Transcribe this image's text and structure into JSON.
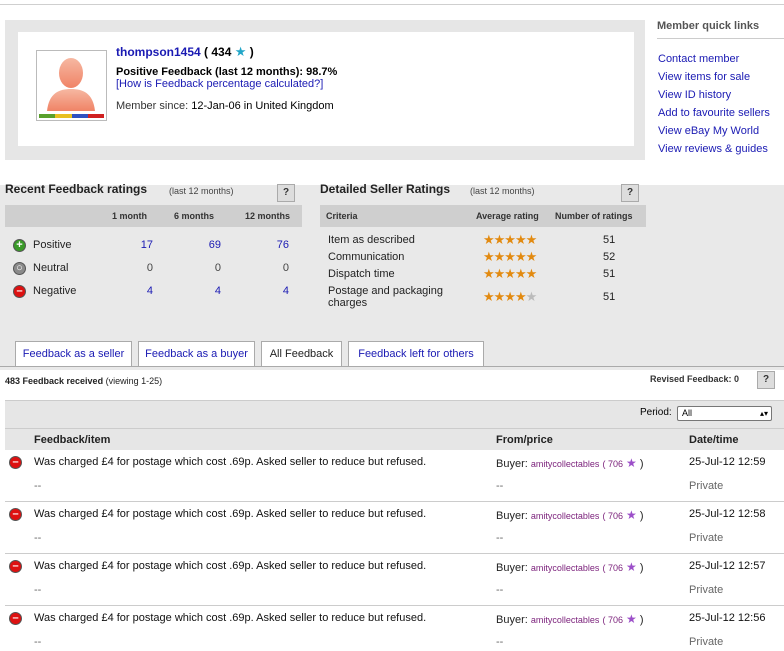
{
  "profile": {
    "username": "thompson1454",
    "score": "434",
    "positive_feedback": "Positive Feedback (last 12 months): 98.7%",
    "how_calc": "[How is Feedback percentage calculated?]",
    "member_since_label": "Member since:",
    "member_since_value": "12-Jan-06 in United Kingdom"
  },
  "quick_links": {
    "title": "Member quick links",
    "items": [
      "Contact member",
      "View items for sale",
      "View ID history",
      "Add to favourite sellers",
      "View eBay My World",
      "View reviews & guides"
    ]
  },
  "recent": {
    "title": "Recent Feedback ratings",
    "sub": "(last 12 months)",
    "help": "?",
    "cols": [
      "1 month",
      "6 months",
      "12 months"
    ],
    "rows": [
      {
        "label": "Positive",
        "v1": "17",
        "v6": "69",
        "v12": "76"
      },
      {
        "label": "Neutral",
        "v1": "0",
        "v6": "0",
        "v12": "0"
      },
      {
        "label": "Negative",
        "v1": "4",
        "v6": "4",
        "v12": "4"
      }
    ]
  },
  "dsr": {
    "title": "Detailed Seller Ratings",
    "sub": "(last 12 months)",
    "help": "?",
    "cols": [
      "Criteria",
      "Average rating",
      "Number of ratings"
    ],
    "rows": [
      {
        "label": "Item as described",
        "rating": 5,
        "count": "51"
      },
      {
        "label": "Communication",
        "rating": 5,
        "count": "52"
      },
      {
        "label": "Dispatch time",
        "rating": 5,
        "count": "51"
      },
      {
        "label": "Postage and packaging",
        "label2": "charges",
        "rating": 4.5,
        "count": "51"
      }
    ]
  },
  "tabs": [
    "Feedback as a seller",
    "Feedback as a buyer",
    "All Feedback",
    "Feedback left for others"
  ],
  "list": {
    "received": "483 Feedback received",
    "viewing": "(viewing 1-25)",
    "revised": "Revised Feedback: 0",
    "revised_help": "?",
    "period_label": "Period:",
    "period_value": "All",
    "headers": [
      "Feedback/item",
      "From/price",
      "Date/time"
    ],
    "rows": [
      {
        "text": "Was charged £4 for postage which cost .69p. Asked seller to reduce but refused.",
        "sub": "--",
        "buyer_label": "Buyer:",
        "buyer": "amitycollectables",
        "score": "706",
        "price": "--",
        "date": "25-Jul-12 12:59",
        "privacy": "Private"
      },
      {
        "text": "Was charged £4 for postage which cost .69p. Asked seller to reduce but refused.",
        "sub": "--",
        "buyer_label": "Buyer:",
        "buyer": "amitycollectables",
        "score": "706",
        "price": "--",
        "date": "25-Jul-12 12:58",
        "privacy": "Private"
      },
      {
        "text": "Was charged £4 for postage which cost .69p. Asked seller to reduce but refused.",
        "sub": "--",
        "buyer_label": "Buyer:",
        "buyer": "amitycollectables",
        "score": "706",
        "price": "--",
        "date": "25-Jul-12 12:57",
        "privacy": "Private"
      },
      {
        "text": "Was charged £4 for postage which cost .69p. Asked seller to reduce but refused.",
        "sub": "--",
        "buyer_label": "Buyer:",
        "buyer": "amitycollectables",
        "score": "706",
        "price": "--",
        "date": "25-Jul-12 12:56",
        "privacy": "Private"
      }
    ]
  },
  "colors": {
    "link": "#1a1ab3",
    "star": "#e28a10",
    "buyer": "#7a1f7a"
  }
}
